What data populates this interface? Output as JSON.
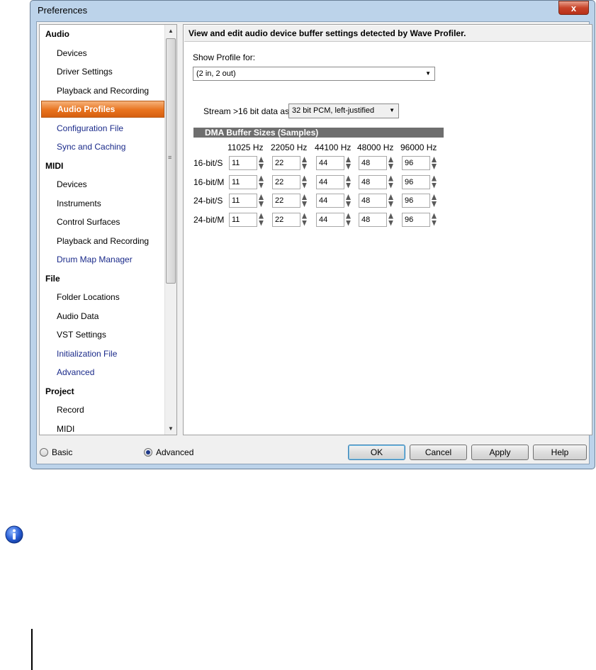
{
  "window": {
    "title": "Preferences",
    "close_glyph": "x"
  },
  "nav": {
    "items": [
      {
        "label": "Audio",
        "kind": "header"
      },
      {
        "label": "Devices",
        "kind": "sub"
      },
      {
        "label": "Driver Settings",
        "kind": "sub"
      },
      {
        "label": "Playback and Recording",
        "kind": "sub"
      },
      {
        "label": "Audio Profiles",
        "kind": "selected"
      },
      {
        "label": "Configuration File",
        "kind": "blue"
      },
      {
        "label": "Sync and Caching",
        "kind": "blue"
      },
      {
        "label": "MIDI",
        "kind": "header"
      },
      {
        "label": "Devices",
        "kind": "sub"
      },
      {
        "label": "Instruments",
        "kind": "sub"
      },
      {
        "label": "Control Surfaces",
        "kind": "sub"
      },
      {
        "label": "Playback and Recording",
        "kind": "sub"
      },
      {
        "label": "Drum Map Manager",
        "kind": "blue"
      },
      {
        "label": "File",
        "kind": "header"
      },
      {
        "label": "Folder Locations",
        "kind": "sub"
      },
      {
        "label": "Audio Data",
        "kind": "sub"
      },
      {
        "label": "VST Settings",
        "kind": "sub"
      },
      {
        "label": "Initialization File",
        "kind": "blue"
      },
      {
        "label": "Advanced",
        "kind": "blue"
      },
      {
        "label": "Project",
        "kind": "header"
      },
      {
        "label": "Record",
        "kind": "sub"
      },
      {
        "label": "MIDI",
        "kind": "sub"
      }
    ],
    "scroll_up_glyph": "▲",
    "scroll_down_glyph": "▼"
  },
  "panel": {
    "header": "View and edit audio device buffer settings detected by Wave Profiler.",
    "show_profile_label": "Show Profile for:",
    "profile_value": "(2 in, 2 out)",
    "stream_label": "Stream >16 bit data as:",
    "stream_value": "32 bit PCM, left-justified",
    "dma_header": "DMA Buffer Sizes (Samples)",
    "columns": [
      "11025 Hz",
      "22050 Hz",
      "44100 Hz",
      "48000 Hz",
      "96000 Hz"
    ],
    "rows": [
      {
        "label": "16-bit/S",
        "values": [
          "11",
          "22",
          "44",
          "48",
          "96"
        ]
      },
      {
        "label": "16-bit/M",
        "values": [
          "11",
          "22",
          "44",
          "48",
          "96"
        ]
      },
      {
        "label": "24-bit/S",
        "values": [
          "11",
          "22",
          "44",
          "48",
          "96"
        ]
      },
      {
        "label": "24-bit/M",
        "values": [
          "11",
          "22",
          "44",
          "48",
          "96"
        ]
      }
    ]
  },
  "mode": {
    "basic_label": "Basic",
    "advanced_label": "Advanced",
    "selected": "Advanced"
  },
  "buttons": {
    "ok": "OK",
    "cancel": "Cancel",
    "apply": "Apply",
    "help": "Help"
  },
  "colors": {
    "selection": "#e8731e",
    "link_blue": "#1a2a8a",
    "dma_header_bg": "#6e6e6e"
  }
}
